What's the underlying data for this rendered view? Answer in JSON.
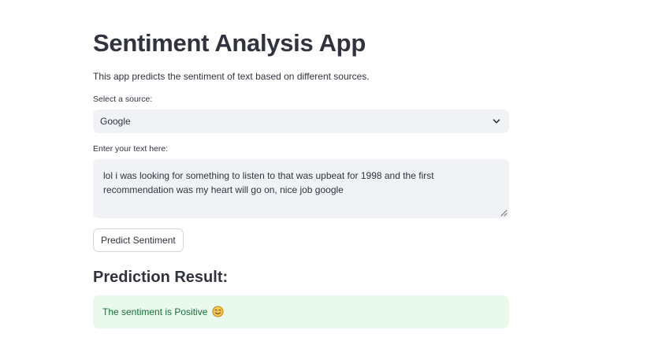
{
  "app": {
    "title": "Sentiment Analysis App",
    "description": "This app predicts the sentiment of text based on different sources."
  },
  "source_select": {
    "label": "Select a source:",
    "selected": "Google",
    "icon": "chevron-down-icon"
  },
  "text_input": {
    "label": "Enter your text here:",
    "value": "lol i was looking for something to listen to that was upbeat for 1998 and the first recommendation was my heart will go on, nice job google"
  },
  "predict_button": {
    "label": "Predict Sentiment"
  },
  "result": {
    "heading": "Prediction Result:",
    "message": "The sentiment is Positive",
    "emoji_icon": "smiling-face-icon"
  },
  "colors": {
    "text": "#31333f",
    "input_bg": "#f0f2f6",
    "success_bg": "#e9f9ee",
    "success_text": "#177233"
  }
}
